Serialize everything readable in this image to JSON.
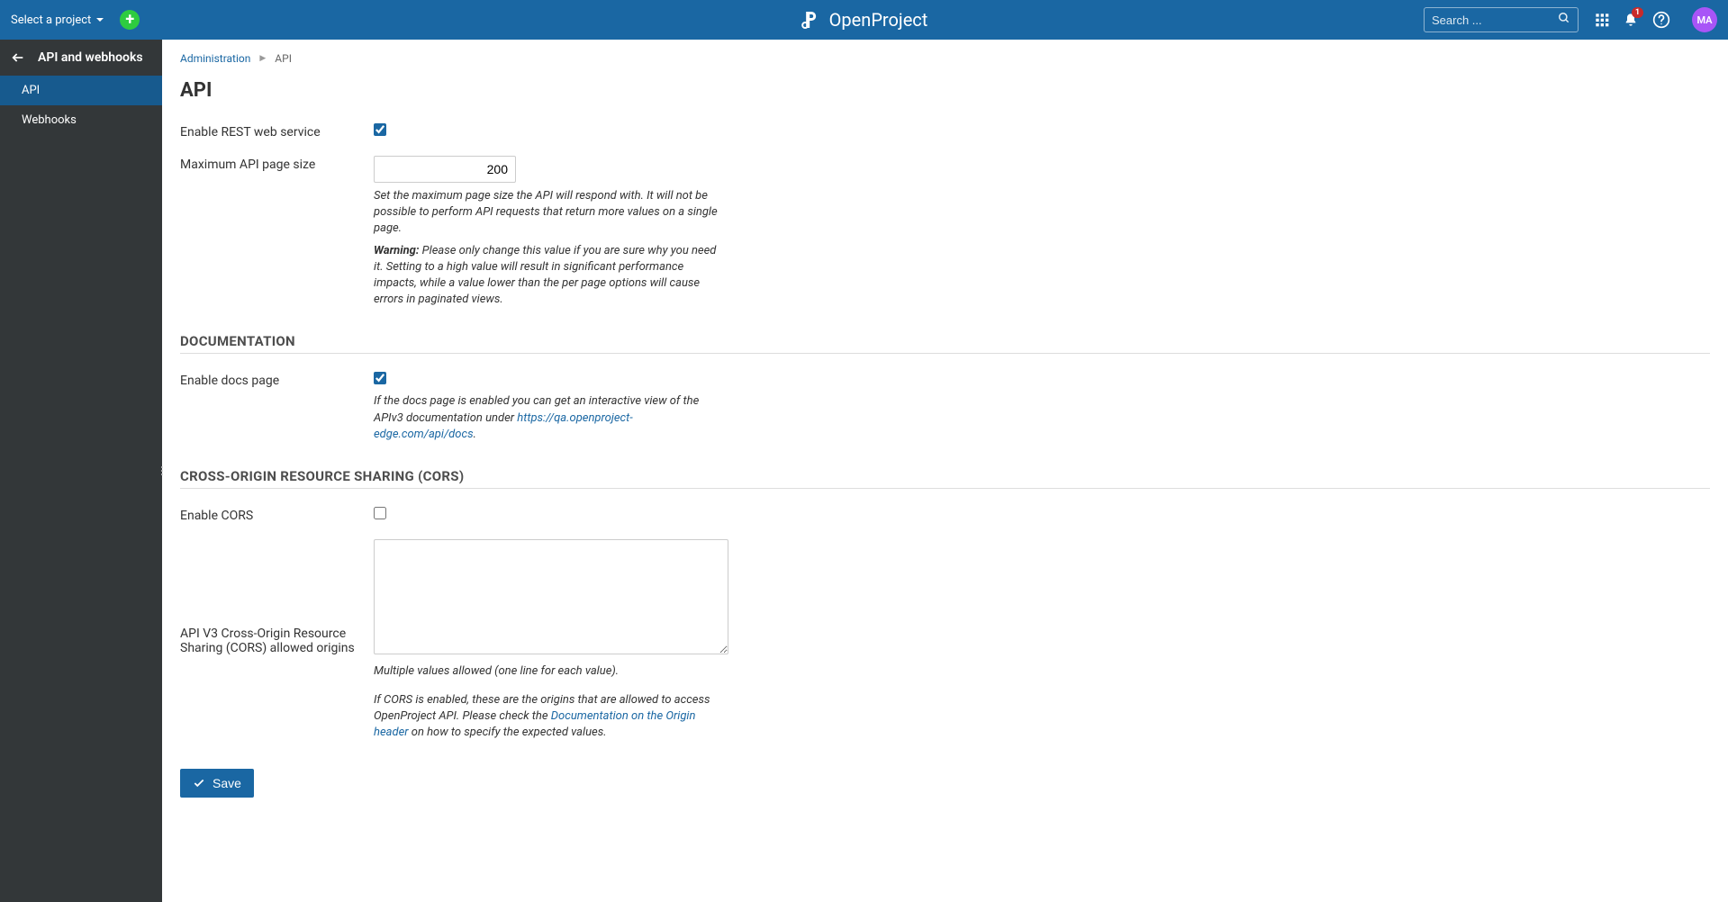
{
  "header": {
    "project_select": "Select a project",
    "app_name": "OpenProject",
    "search_placeholder": "Search ...",
    "notification_count": "1",
    "avatar_initials": "MA"
  },
  "sidebar": {
    "title": "API and webhooks",
    "items": [
      {
        "label": "API",
        "active": true
      },
      {
        "label": "Webhooks",
        "active": false
      }
    ]
  },
  "breadcrumb": {
    "root": "Administration",
    "current": "API"
  },
  "page": {
    "title": "API",
    "rest": {
      "label": "Enable REST web service",
      "checked": true
    },
    "page_size": {
      "label": "Maximum API page size",
      "value": "200",
      "help1": "Set the maximum page size the API will respond with. It will not be possible to perform API requests that return more values on a single page.",
      "warning_label": "Warning:",
      "help2": " Please only change this value if you are sure why you need it. Setting to a high value will result in significant performance impacts, while a value lower than the per page options will cause errors in paginated views."
    },
    "doc_section": "DOCUMENTATION",
    "docs": {
      "label": "Enable docs page",
      "checked": true,
      "help_prefix": "If the docs page is enabled you can get an interactive view of the APIv3 documentation under ",
      "help_link": "https://qa.openproject-edge.com/api/docs",
      "help_suffix": "."
    },
    "cors_section": "CROSS-ORIGIN RESOURCE SHARING (CORS)",
    "cors": {
      "label": "Enable CORS",
      "checked": false
    },
    "origins": {
      "label": "API V3 Cross-Origin Resource Sharing (CORS) allowed origins",
      "value": "",
      "help1": "Multiple values allowed (one line for each value).",
      "help2_prefix": "If CORS is enabled, these are the origins that are allowed to access OpenProject API. Please check the ",
      "help2_link": "Documentation on the Origin header",
      "help2_suffix": " on how to specify the expected values."
    },
    "save_label": "Save"
  }
}
